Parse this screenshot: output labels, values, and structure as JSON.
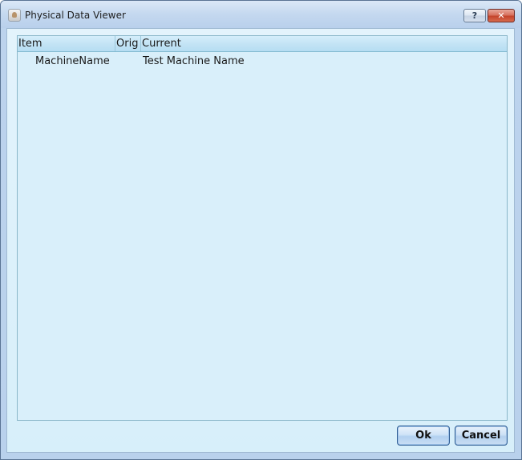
{
  "window": {
    "title": "Physical Data Viewer",
    "app_icon": "application-icon",
    "help_label": "?",
    "close_label": "✕"
  },
  "grid": {
    "columns": [
      "Item",
      "Orig",
      "Current"
    ],
    "rows": [
      {
        "item": "MachineName",
        "orig": "",
        "current": "Test Machine Name"
      }
    ]
  },
  "buttons": {
    "ok_label": "Ok",
    "cancel_label": "Cancel"
  },
  "colors": {
    "grid_background": "#d9effa",
    "header_background": "#c4e4f5",
    "close_button": "#c4442b"
  }
}
